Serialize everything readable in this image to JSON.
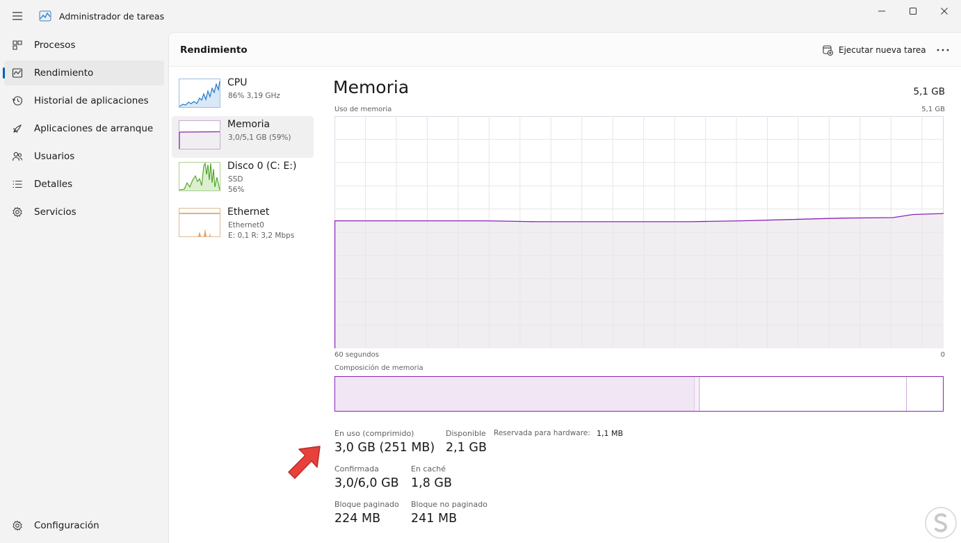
{
  "window": {
    "title": "Administrador de tareas"
  },
  "nav": {
    "items": [
      {
        "label": "Procesos",
        "active": false
      },
      {
        "label": "Rendimiento",
        "active": true
      },
      {
        "label": "Historial de aplicaciones",
        "active": false
      },
      {
        "label": "Aplicaciones de arranque",
        "active": false
      },
      {
        "label": "Usuarios",
        "active": false
      },
      {
        "label": "Detalles",
        "active": false
      },
      {
        "label": "Servicios",
        "active": false
      }
    ],
    "settings": "Configuración"
  },
  "cmdbar": {
    "title": "Rendimiento",
    "run_task": "Ejecutar nueva tarea"
  },
  "devices": [
    {
      "name": "CPU",
      "lines": [
        "86% 3,19 GHz"
      ],
      "color": "#1e78c8"
    },
    {
      "name": "Memoria",
      "lines": [
        "3,0/5,1 GB (59%)"
      ],
      "color": "#8b22b4"
    },
    {
      "name": "Disco 0 (C: E:)",
      "lines": [
        "SSD",
        "56%"
      ],
      "color": "#4ca020"
    },
    {
      "name": "Ethernet",
      "lines": [
        "Ethernet0",
        "E: 0,1 R: 3,2 Mbps"
      ],
      "color": "#b4641e"
    }
  ],
  "memory": {
    "title": "Memoria",
    "total": "5,1 GB",
    "usage_label": "Uso de memoria",
    "usage_max": "5,1 GB",
    "time_label": "60 segundos",
    "time_end": "0",
    "composition_label": "Composición de memoria",
    "composition_fractions": {
      "in_use": 0.591,
      "modified": 0.008,
      "standby": 0.34,
      "free": 0.061
    },
    "stats": {
      "in_use_label": "En uso (comprimido)",
      "in_use_value": "3,0 GB (251 MB)",
      "available_label": "Disponible",
      "available_value": "2,1 GB",
      "reserved_label": "Reservada para hardware:",
      "reserved_value": "1,1 MB",
      "committed_label": "Confirmada",
      "committed_value": "3,0/6,0 GB",
      "cached_label": "En caché",
      "cached_value": "1,8 GB",
      "paged_label": "Bloque paginado",
      "paged_value": "224 MB",
      "nonpaged_label": "Bloque no paginado",
      "nonpaged_value": "241 MB"
    }
  },
  "chart_data": {
    "type": "area",
    "title": "Uso de memoria",
    "xlabel": "60 segundos",
    "ylabel": "",
    "ylim": [
      0,
      5.1
    ],
    "x": [
      60,
      55,
      50,
      45,
      40,
      35,
      30,
      25,
      20,
      15,
      10,
      5,
      3,
      0
    ],
    "series": [
      {
        "name": "",
        "values": [
          2.8,
          2.8,
          2.8,
          2.8,
          2.78,
          2.78,
          2.78,
          2.78,
          2.8,
          2.83,
          2.86,
          2.87,
          2.94,
          2.96
        ]
      }
    ]
  },
  "colors": {
    "accent": "#005fb8",
    "memory": "#8b22b4",
    "memory_fill": "#f1eef2",
    "arrow": "#e8413b"
  }
}
